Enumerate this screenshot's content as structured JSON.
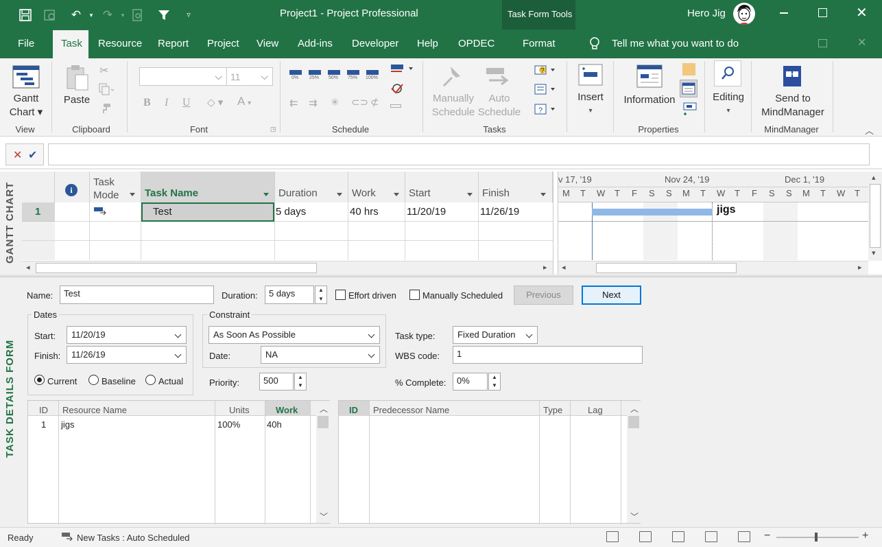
{
  "titlebar": {
    "title": "Project1  -  Project Professional",
    "context_group": "Task Form Tools",
    "user": "Hero Jig"
  },
  "menu": [
    "File",
    "Task",
    "Resource",
    "Report",
    "Project",
    "View",
    "Add-ins",
    "Developer",
    "Help",
    "OPDEC",
    "Format"
  ],
  "tell_me": "Tell me what you want to do",
  "ribbon": {
    "gantt_chart": [
      "Gantt",
      "Chart"
    ],
    "paste": "Paste",
    "font_size": "11",
    "manually_schedule": [
      "Manually",
      "Schedule"
    ],
    "auto_schedule": [
      "Auto",
      "Schedule"
    ],
    "insert": "Insert",
    "information": "Information",
    "editing": "Editing",
    "send_to": [
      "Send to",
      "MindManager"
    ],
    "pct": [
      "0%",
      "25%",
      "50%",
      "75%",
      "100%"
    ],
    "groups": [
      "View",
      "Clipboard",
      "Font",
      "Schedule",
      "Tasks",
      "Properties",
      "MindManager"
    ]
  },
  "gantt": {
    "side_label": "GANTT CHART",
    "headers": [
      "Task Mode",
      "Task Name",
      "Duration",
      "Work",
      "Start",
      "Finish"
    ],
    "row": {
      "id": "1",
      "name": "Test",
      "duration": "5 days",
      "work": "40 hrs",
      "start": "11/20/19",
      "finish": "11/26/19"
    },
    "timescale_weeks": [
      "v 17, '19",
      "Nov 24, '19",
      "Dec 1, '19"
    ],
    "weekdays": [
      "M",
      "T",
      "W",
      "T",
      "F",
      "S",
      "S",
      "M",
      "T",
      "W",
      "T",
      "F",
      "S",
      "S",
      "M",
      "T",
      "W",
      "T"
    ],
    "bar_label": "jigs"
  },
  "form": {
    "side_label": "TASK DETAILS FORM",
    "name_label": "Name:",
    "name_value": "Test",
    "duration_label": "Duration:",
    "duration_value": "5 days",
    "effort_driven": "Effort driven",
    "manually_scheduled": "Manually Scheduled",
    "previous": "Previous",
    "next": "Next",
    "dates_label": "Dates",
    "start_label": "Start:",
    "start_value": "11/20/19",
    "finish_label": "Finish:",
    "finish_value": "11/26/19",
    "current": "Current",
    "baseline": "Baseline",
    "actual": "Actual",
    "constraint_label": "Constraint",
    "constraint_value": "As Soon As Possible",
    "date_label": "Date:",
    "date_value": "NA",
    "priority_label": "Priority:",
    "priority_value": "500",
    "task_type_label": "Task type:",
    "task_type_value": "Fixed Duration",
    "wbs_label": "WBS code:",
    "wbs_value": "1",
    "complete_label": "% Complete:",
    "complete_value": "0%",
    "res_headers": [
      "ID",
      "Resource Name",
      "Units",
      "Work"
    ],
    "res_row": {
      "id": "1",
      "name": "jigs",
      "units": "100%",
      "work": "40h"
    },
    "pred_headers": [
      "ID",
      "Predecessor Name",
      "Type",
      "Lag"
    ]
  },
  "status": {
    "ready": "Ready",
    "new_tasks": "New Tasks : Auto Scheduled"
  }
}
